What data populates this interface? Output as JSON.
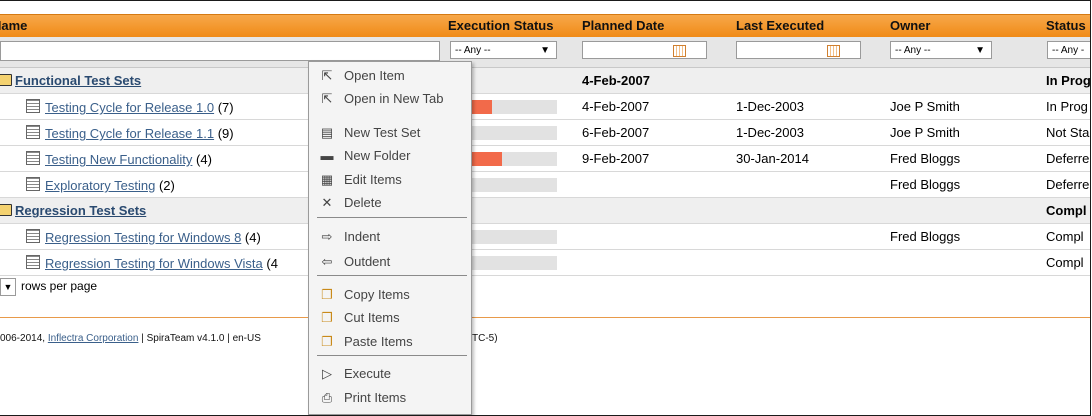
{
  "columns": {
    "name": "Name",
    "execution_status": "Execution Status",
    "planned_date": "Planned Date",
    "last_executed": "Last Executed",
    "owner": "Owner",
    "status": "Status"
  },
  "filters": {
    "execution_status": "-- Any --",
    "owner": "-- Any --",
    "status": "-- Any -"
  },
  "rows": [
    {
      "type": "folder",
      "name": "Functional Test Sets",
      "count": "",
      "planned": "4-Feb-2007",
      "last": "",
      "owner": "",
      "status": "In Prog"
    },
    {
      "type": "set",
      "name": "Testing Cycle for Release 1.0",
      "count": "(7)",
      "planned": "4-Feb-2007",
      "last": "1-Dec-2003",
      "owner": "Joe P Smith",
      "status": "In Prog",
      "bar": {
        "green": 0,
        "red": 0.4
      }
    },
    {
      "type": "set",
      "name": "Testing Cycle for Release 1.1",
      "count": "(9)",
      "planned": "6-Feb-2007",
      "last": "1-Dec-2003",
      "owner": "Joe P Smith",
      "status": "Not Sta",
      "bar": {
        "green": 0.12,
        "red": 0
      }
    },
    {
      "type": "set",
      "name": "Testing New Functionality",
      "count": "(4)",
      "planned": "9-Feb-2007",
      "last": "30-Jan-2014",
      "owner": "Fred Bloggs",
      "status": "Deferre",
      "bar": {
        "green": 0.1,
        "red": 0.38
      }
    },
    {
      "type": "set",
      "name": "Exploratory Testing",
      "count": "(2)",
      "planned": "",
      "last": "",
      "owner": "Fred Bloggs",
      "status": "Deferre",
      "bar": {
        "green": 0,
        "red": 0
      }
    },
    {
      "type": "folder",
      "name": "Regression Test Sets",
      "count": "",
      "planned": "",
      "last": "",
      "owner": "",
      "status": "Compl"
    },
    {
      "type": "set",
      "name": "Regression Testing for Windows 8",
      "count": "(4)",
      "planned": "",
      "last": "",
      "owner": "Fred Bloggs",
      "status": "Compl",
      "bar": {
        "green": 0,
        "red": 0
      }
    },
    {
      "type": "set",
      "name": "Regression Testing for Windows Vista",
      "count": "(4",
      "planned": "",
      "last": "",
      "owner": "",
      "status": "Compl",
      "bar": {
        "green": 0,
        "red": 0
      }
    }
  ],
  "pager": {
    "label": "rows per page"
  },
  "footer": {
    "prefix": "006-2014, ",
    "company": "Inflectra Corporation",
    "mid": " | SpiraTeam v4.1.0 | en-US",
    "tz": "TC-5)"
  },
  "context_menu": {
    "items": [
      {
        "label": "Open Item",
        "icon": "cursor-icon",
        "glyph": "⇱"
      },
      {
        "label": "Open in New Tab",
        "icon": "cursor-new-tab-icon",
        "glyph": "⇱"
      },
      {
        "label": "New Test Set",
        "icon": "test-set-icon",
        "glyph": "▤"
      },
      {
        "label": "New Folder",
        "icon": "folder-icon",
        "glyph": "▬"
      },
      {
        "label": "Edit Items",
        "icon": "edit-grid-icon",
        "glyph": "▦"
      },
      {
        "label": "Delete",
        "icon": "delete-icon",
        "glyph": "✕"
      },
      {
        "label": "Indent",
        "icon": "arrow-right-icon",
        "glyph": "⇨"
      },
      {
        "label": "Outdent",
        "icon": "arrow-left-icon",
        "glyph": "⇦"
      },
      {
        "label": "Copy Items",
        "icon": "copy-icon",
        "glyph": "❐"
      },
      {
        "label": "Cut Items",
        "icon": "cut-icon",
        "glyph": "❐"
      },
      {
        "label": "Paste Items",
        "icon": "paste-icon",
        "glyph": "❐"
      },
      {
        "label": "Execute",
        "icon": "play-icon",
        "glyph": "▷"
      },
      {
        "label": "Print Items",
        "icon": "print-icon",
        "glyph": "⎙"
      }
    ]
  },
  "colors": {
    "header_orange": "#f08a16",
    "bar_green": "#7be36b",
    "bar_red": "#f26a4a",
    "link_blue": "#3a5f8a"
  }
}
